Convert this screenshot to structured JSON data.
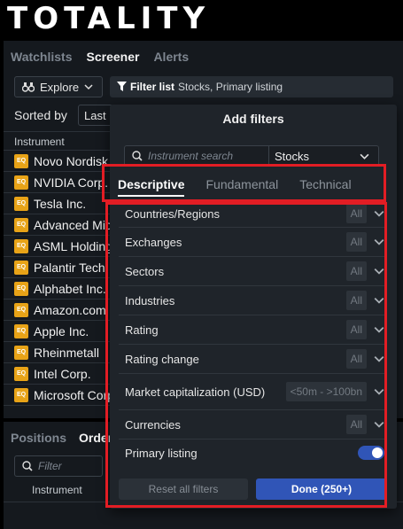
{
  "brand": {
    "logo": "TOTALITY"
  },
  "top_tabs": [
    {
      "label": "Watchlists",
      "active": false
    },
    {
      "label": "Screener",
      "active": true
    },
    {
      "label": "Alerts",
      "active": false
    }
  ],
  "toolbar": {
    "explore_label": "Explore",
    "filter_list_label": "Filter list",
    "filter_list_value": "Stocks, Primary listing"
  },
  "sorting": {
    "label": "Sorted by",
    "value": "Last"
  },
  "instrument_list": {
    "header": "Instrument",
    "badge": "EQ",
    "rows": [
      "Novo Nordisk",
      "NVIDIA Corp.",
      "Tesla Inc.",
      "Advanced Micro",
      "ASML Holding",
      "Palantir Tech",
      "Alphabet Inc.",
      "Amazon.com",
      "Apple Inc.",
      "Rheinmetall",
      "Intel Corp.",
      "Microsoft Corp."
    ]
  },
  "bottom": {
    "tabs": [
      {
        "label": "Positions",
        "active": false
      },
      {
        "label": "Orders",
        "active": true
      }
    ],
    "search_placeholder": "Filter",
    "column_header": "Instrument"
  },
  "modal": {
    "title": "Add filters",
    "search_placeholder": "Instrument search",
    "asset_type": "Stocks",
    "tabs": [
      {
        "label": "Descriptive",
        "active": true
      },
      {
        "label": "Fundamental",
        "active": false
      },
      {
        "label": "Technical",
        "active": false
      }
    ],
    "filters": [
      {
        "label": "Countries/Regions",
        "value": "All"
      },
      {
        "label": "Exchanges",
        "value": "All"
      },
      {
        "label": "Sectors",
        "value": "All"
      },
      {
        "label": "Industries",
        "value": "All"
      },
      {
        "label": "Rating",
        "value": "All"
      },
      {
        "label": "Rating change",
        "value": "All"
      },
      {
        "label": "Market capitalization (USD)",
        "value": "<50m - >100bn"
      },
      {
        "label": "Currencies",
        "value": "All"
      }
    ],
    "primary_listing": {
      "label": "Primary listing",
      "enabled": true
    },
    "reset_label": "Reset all filters",
    "done_label": "Done (250+)"
  },
  "colors": {
    "accent": "#3055b7",
    "badge": "#e8a317",
    "highlight": "#e21d24"
  }
}
